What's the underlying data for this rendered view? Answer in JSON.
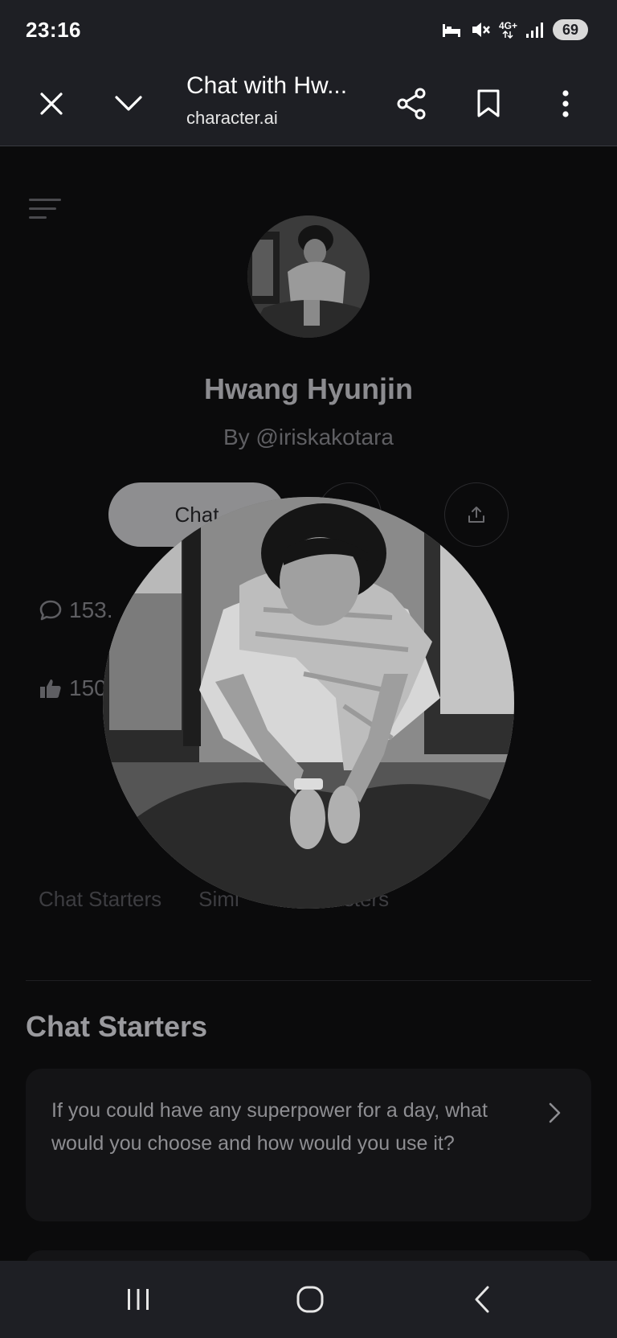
{
  "status_bar": {
    "time": "23:16",
    "network": "4G+",
    "battery": "69",
    "icons": [
      "sleep-mode-icon",
      "mute-icon",
      "signal-icon"
    ]
  },
  "browser": {
    "title": "Chat with Hw...",
    "url": "character.ai",
    "icons": [
      "close-icon",
      "chevron-down-icon",
      "share-icon",
      "bookmark-icon",
      "more-vert-icon"
    ]
  },
  "profile": {
    "name": "Hwang Hyunjin",
    "author": "By @iriskakotara",
    "chat_button": "Chat",
    "stats": {
      "chats": "153.",
      "likes": "150"
    }
  },
  "tabs": [
    "Chat Starters",
    "Simi",
    "sters"
  ],
  "chat_starters": {
    "title": "Chat Starters",
    "items": [
      "If you could have any superpower for a day, what would you choose and how would you use it?"
    ]
  },
  "colors": {
    "chrome": "#1e1f24",
    "page_background": "#0b0b0c",
    "chat_button": "#8e8e90"
  }
}
